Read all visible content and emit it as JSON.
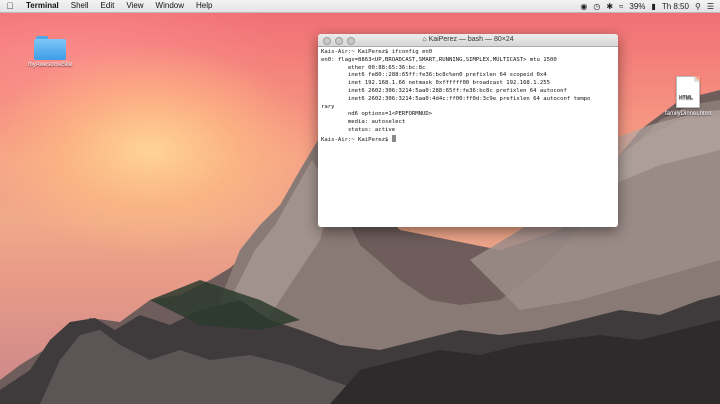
{
  "menubar": {
    "apple": "",
    "items": [
      "Terminal",
      "Shell",
      "Edit",
      "View",
      "Window",
      "Help"
    ],
    "battery": "39%",
    "clock": "Th 8:50"
  },
  "desktop_icons": [
    {
      "label": "myAwesomeSite",
      "kind": "folder-icon"
    },
    {
      "label": "familyDinner.html",
      "kind": "html-file-icon",
      "badge": "HTML"
    }
  ],
  "terminal": {
    "title": "KaiPerez — bash — 80×24",
    "lines": [
      "Kais-Air:~ KaiPerez$ ifconfig en0",
      "en0: flags=8863<UP,BROADCAST,SMART,RUNNING,SIMPLEX,MULTICAST> mtu 1500",
      "        ether 00:88:65:36:bc:8c",
      "        inet6 fe80::288:65ff:fe36:bc8c%en0 prefixlen 64 scopeid 0x4",
      "        inet 192.168.1.66 netmask 0xffffff00 broadcast 192.168.1.255",
      "        inet6 2602:306:3214:5aa0:288:65ff:fe36:bc8c prefixlen 64 autoconf",
      "        inet6 2602:306:3214:5aa0:4d4c:ff00:ff0d:3c9e prefixlen 64 autoconf tempo",
      "rary",
      "        nd6 options=1<PERFORMNUD>",
      "        media: autoselect",
      "        status: active",
      "Kais-Air:~ KaiPerez$ "
    ]
  }
}
